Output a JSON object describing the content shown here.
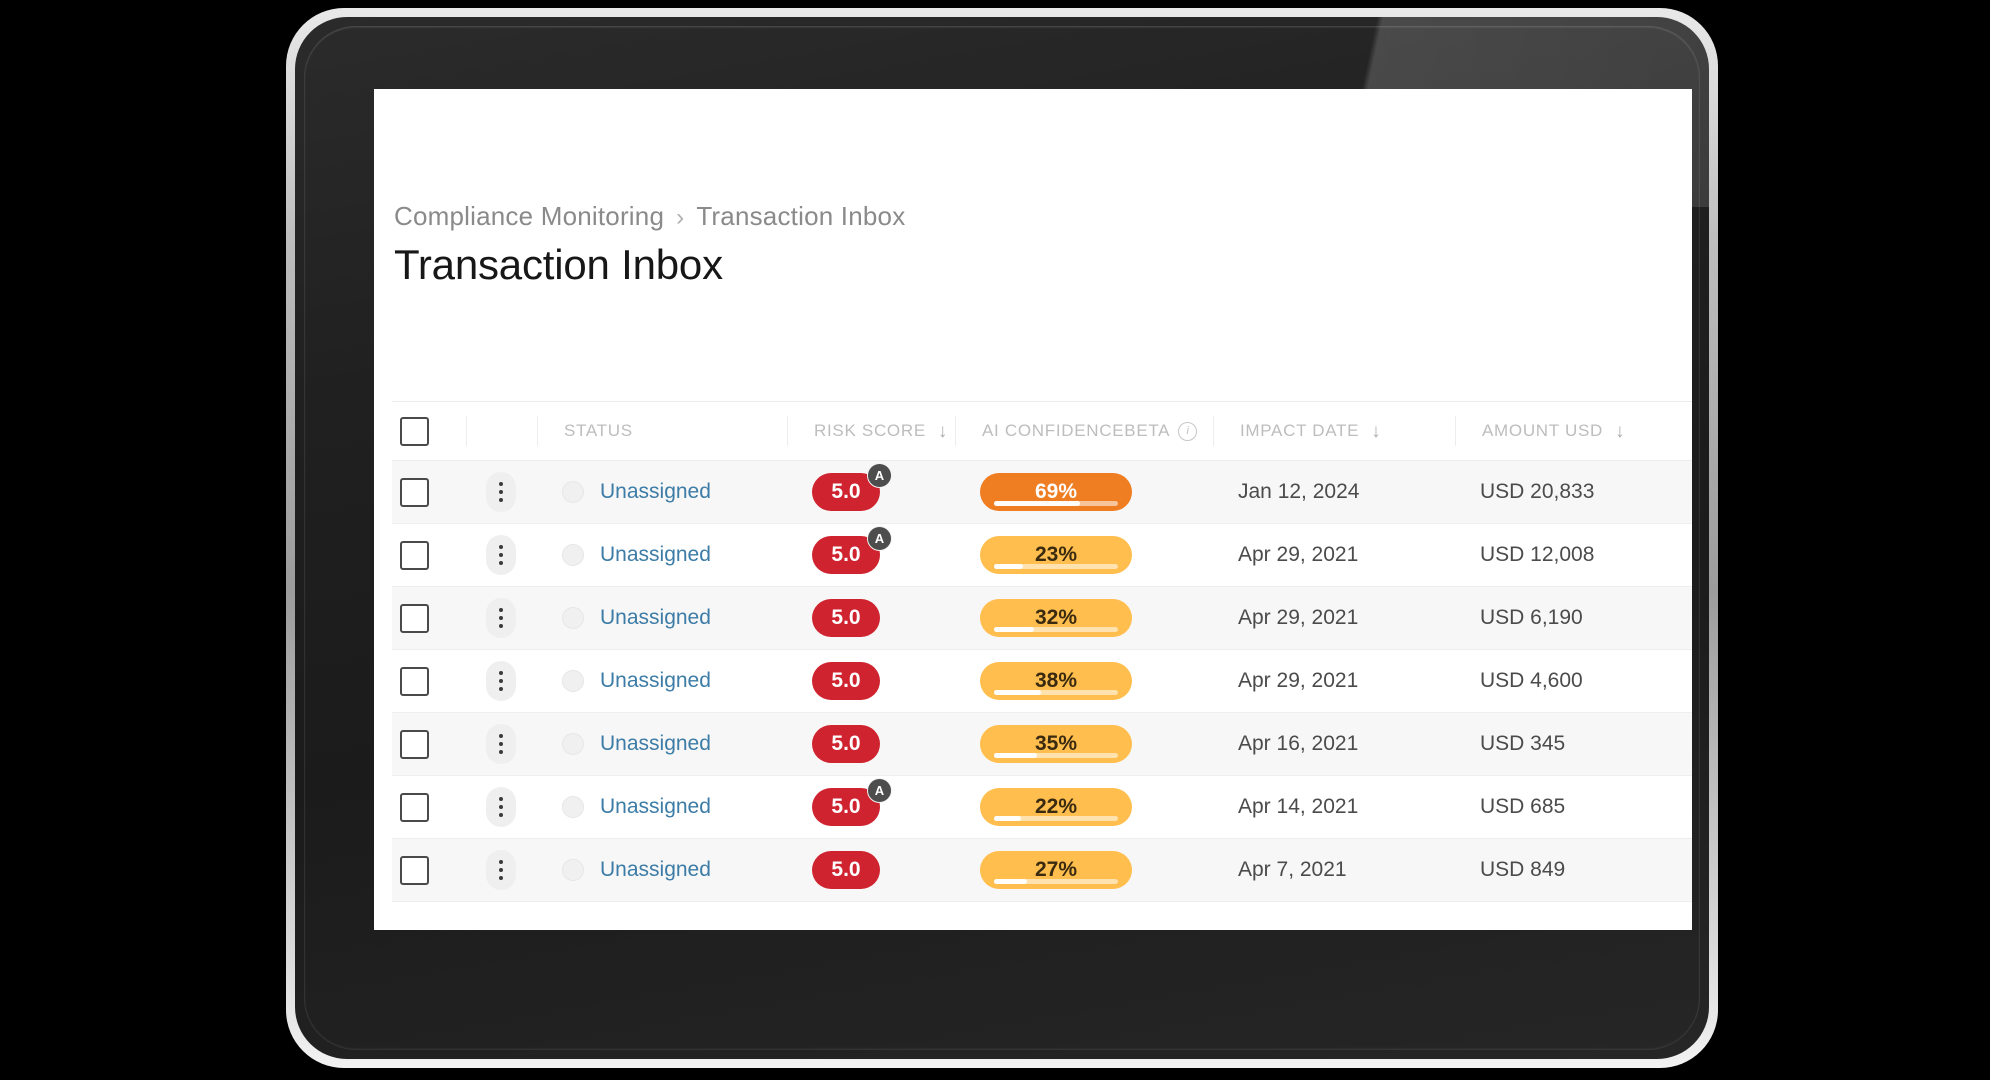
{
  "breadcrumb": {
    "parent": "Compliance Monitoring",
    "separator": "›",
    "current": "Transaction Inbox"
  },
  "page": {
    "title": "Transaction Inbox"
  },
  "colors": {
    "risk_pill": "#CF2430",
    "confidence_high": "#EF7D22",
    "confidence_low": "#FFBE4D",
    "status_link": "#3C7CA6",
    "ai_badge": "#4D4D4D",
    "row_stripe": "#F7F7F7"
  },
  "table": {
    "columns": [
      {
        "key": "select",
        "label": "",
        "sortable": false,
        "icon": "checkbox-icon"
      },
      {
        "key": "menu",
        "label": "",
        "sortable": false,
        "icon": "kebab-menu-icon"
      },
      {
        "key": "status",
        "label": "STATUS",
        "sortable": false
      },
      {
        "key": "risk_score",
        "label": "RISK SCORE",
        "sortable": true,
        "sort_icon": "↓"
      },
      {
        "key": "ai_confidence",
        "label": "AI CONFIDENCE",
        "badge": "BETA",
        "info": "i",
        "sortable": false
      },
      {
        "key": "impact_date",
        "label": "IMPACT DATE",
        "sortable": true,
        "sort_icon": "↓"
      },
      {
        "key": "amount_usd",
        "label": "AMOUNT USD",
        "sortable": true,
        "sort_icon": "↓"
      }
    ],
    "header_select_all": false,
    "rows": [
      {
        "selected": false,
        "status": "Unassigned",
        "risk_score": "5.0",
        "ai_flag": "A",
        "confidence": "69%",
        "confidence_pct": 69,
        "impact_date": "Jan 12, 2024",
        "amount": "USD 20,833"
      },
      {
        "selected": false,
        "status": "Unassigned",
        "risk_score": "5.0",
        "ai_flag": "A",
        "confidence": "23%",
        "confidence_pct": 23,
        "impact_date": "Apr 29, 2021",
        "amount": "USD 12,008"
      },
      {
        "selected": false,
        "status": "Unassigned",
        "risk_score": "5.0",
        "ai_flag": "",
        "confidence": "32%",
        "confidence_pct": 32,
        "impact_date": "Apr 29, 2021",
        "amount": "USD 6,190"
      },
      {
        "selected": false,
        "status": "Unassigned",
        "risk_score": "5.0",
        "ai_flag": "",
        "confidence": "38%",
        "confidence_pct": 38,
        "impact_date": "Apr 29, 2021",
        "amount": "USD 4,600"
      },
      {
        "selected": false,
        "status": "Unassigned",
        "risk_score": "5.0",
        "ai_flag": "",
        "confidence": "35%",
        "confidence_pct": 35,
        "impact_date": "Apr 16, 2021",
        "amount": "USD 345"
      },
      {
        "selected": false,
        "status": "Unassigned",
        "risk_score": "5.0",
        "ai_flag": "A",
        "confidence": "22%",
        "confidence_pct": 22,
        "impact_date": "Apr 14, 2021",
        "amount": "USD 685"
      },
      {
        "selected": false,
        "status": "Unassigned",
        "risk_score": "5.0",
        "ai_flag": "",
        "confidence": "27%",
        "confidence_pct": 27,
        "impact_date": "Apr 7, 2021",
        "amount": "USD 849"
      }
    ]
  }
}
